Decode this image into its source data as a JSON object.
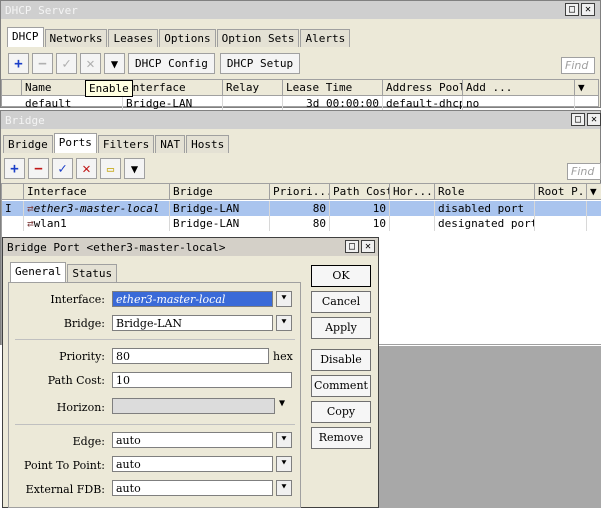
{
  "dhcp": {
    "title": "DHCP Server",
    "tabs": [
      "DHCP",
      "Networks",
      "Leases",
      "Options",
      "Option Sets",
      "Alerts"
    ],
    "buttons": {
      "config": "DHCP Config",
      "setup": "DHCP Setup"
    },
    "tooltip": "Enable",
    "find": "Find",
    "columns": [
      "Name",
      "Interface",
      "Relay",
      "Lease Time",
      "Address Pool",
      "Add ..."
    ],
    "row": {
      "name": "default",
      "interface": "Bridge-LAN",
      "relay": "",
      "lease": "3d 00:00:00",
      "pool": "default-dhcp",
      "add": "no"
    }
  },
  "bridge": {
    "title": "Bridge",
    "tabs": [
      "Bridge",
      "Ports",
      "Filters",
      "NAT",
      "Hosts"
    ],
    "find": "Find",
    "columns": [
      "Interface",
      "Bridge",
      "Priori...",
      "Path Cost",
      "Hor...",
      "Role",
      "Root P..."
    ],
    "rows": [
      {
        "flag": "I",
        "interface": "ether3-master-local",
        "bridge": "Bridge-LAN",
        "priority": "80",
        "path_cost": "10",
        "horizon": "",
        "role": "disabled port",
        "root": ""
      },
      {
        "flag": "",
        "interface": "wlan1",
        "bridge": "Bridge-LAN",
        "priority": "80",
        "path_cost": "10",
        "horizon": "",
        "role": "designated port",
        "root": ""
      }
    ]
  },
  "dialog": {
    "title": "Bridge Port <ether3-master-local>",
    "tabs": [
      "General",
      "Status"
    ],
    "labels": {
      "interface": "Interface:",
      "bridge": "Bridge:",
      "priority": "Priority:",
      "path_cost": "Path Cost:",
      "horizon": "Horizon:",
      "edge": "Edge:",
      "p2p": "Point To Point:",
      "ext_fdb": "External FDB:"
    },
    "values": {
      "interface": "ether3-master-local",
      "bridge": "Bridge-LAN",
      "priority": "80",
      "priority_unit": "hex",
      "path_cost": "10",
      "horizon": "",
      "edge": "auto",
      "p2p": "auto",
      "ext_fdb": "auto"
    },
    "buttons": [
      "OK",
      "Cancel",
      "Apply",
      "Disable",
      "Comment",
      "Copy",
      "Remove"
    ]
  }
}
